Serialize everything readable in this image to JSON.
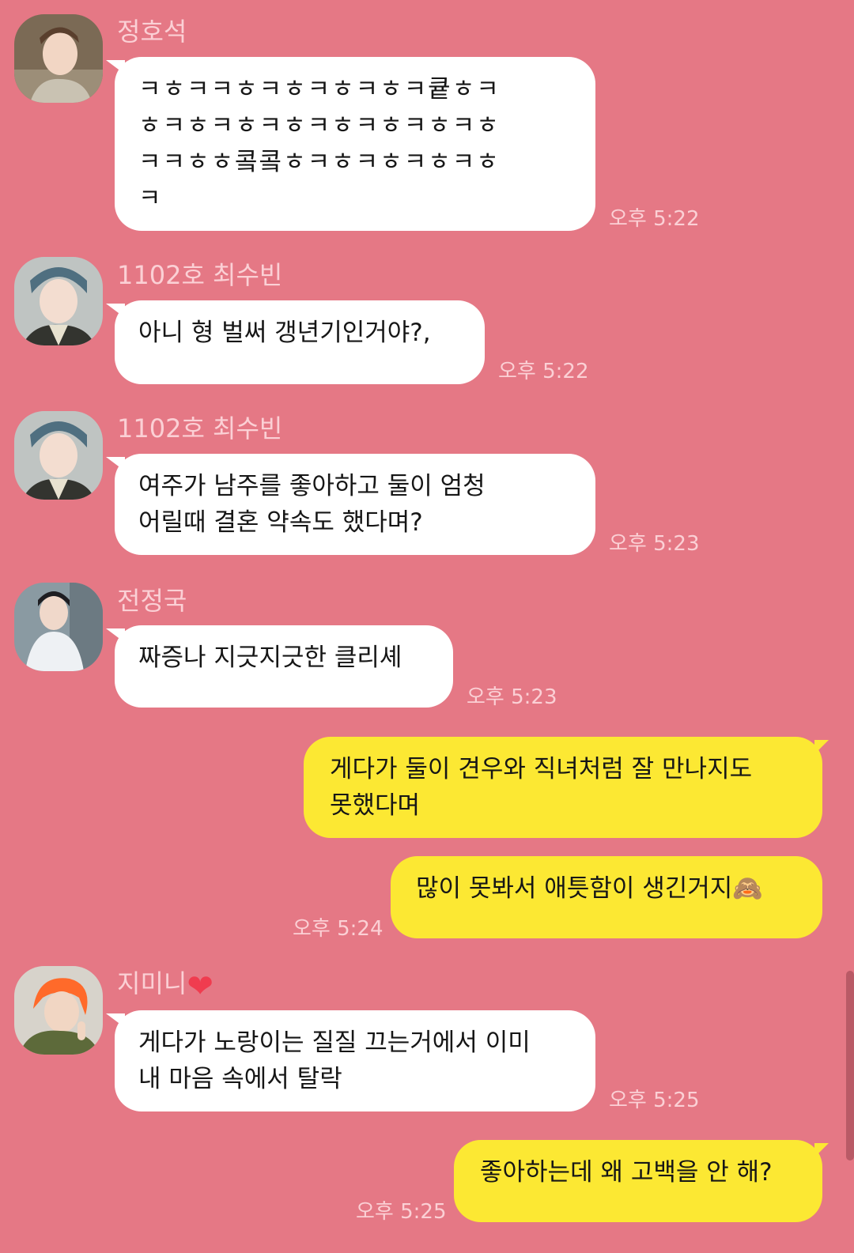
{
  "messages": [
    {
      "sender": "정호석",
      "text": "ㅋㅎㅋㅋㅎㅋㅎㅋㅎㅋㅎㅋ큩ㅎㅋ\nㅎㅋㅎㅋㅎㅋㅎㅋㅎㅋㅎㅋㅎㅋㅎ\nㅋㅋㅎㅎ콬콬ㅎㅋㅎㅋㅎㅋㅎㅋㅎ\nㅋ",
      "time": "오후 5:22"
    },
    {
      "sender": "1102호 최수빈",
      "text": "아니 형 벌써 갱년기인거야?,",
      "time": "오후 5:22"
    },
    {
      "sender": "1102호 최수빈",
      "text": "여주가 남주를 좋아하고 둘이 엄청\n어릴때 결혼 약속도 했다며?",
      "time": "오후 5:23"
    },
    {
      "sender": "전정국",
      "text": "짜증나 지긋지긋한 클리셰",
      "time": "오후 5:23"
    },
    {
      "text": "게다가 둘이 견우와 직녀처럼 잘 만나지도\n못했다며"
    },
    {
      "text": "많이 못봐서 애틋함이 생긴거지🙈",
      "time": "오후 5:24"
    },
    {
      "sender": "지미니",
      "sender_emoji": "❤",
      "text": "게다가 노랑이는 질질 끄는거에서 이미\n내 마음 속에서 탈락",
      "time": "오후 5:25"
    },
    {
      "text": "좋아하는데 왜 고백을 안 해?",
      "time": "오후 5:25"
    }
  ],
  "colors": {
    "background": "#e57885",
    "incoming_bubble": "#ffffff",
    "outgoing_bubble": "#fce833",
    "meta_text": "#fbd0d5"
  }
}
